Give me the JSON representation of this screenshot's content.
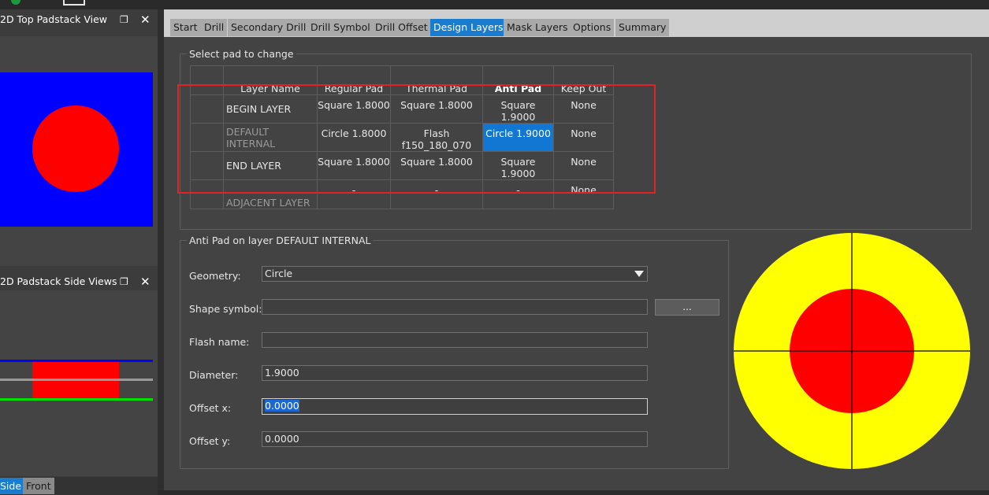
{
  "left": {
    "top_view_title": "2D Top Padstack View",
    "side_view_title": "2D Padstack Side Views",
    "view_tabs": [
      "Side",
      "Front"
    ],
    "colors": {
      "pad_bg": "#0000ff",
      "pad": "#ff0000",
      "layer_top": "#0000ff",
      "layer_mid": "#9a9a9a",
      "layer_bot": "#00e000"
    }
  },
  "tabs": [
    "Start",
    "Drill",
    "Secondary Drill",
    "Drill Symbol",
    "Drill Offset",
    "Design Layers",
    "Mask Layers",
    "Options",
    "Summary"
  ],
  "active_tab": "Design Layers",
  "select_group": {
    "title": "Select pad to change",
    "columns": [
      "Layer Name",
      "Regular Pad",
      "Thermal Pad",
      "Anti Pad",
      "Keep Out"
    ],
    "rows": [
      {
        "layer": "BEGIN LAYER",
        "regular": "Square 1.8000",
        "thermal": "Square 1.8000",
        "anti": "Square 1.9000",
        "keepout": "None"
      },
      {
        "layer": "DEFAULT INTERNAL",
        "regular": "Circle 1.8000",
        "thermal": "Flash f150_180_070",
        "anti": "Circle 1.9000",
        "keepout": "None"
      },
      {
        "layer": "END LAYER",
        "regular": "Square 1.8000",
        "thermal": "Square 1.8000",
        "anti": "Square 1.9000",
        "keepout": "None"
      },
      {
        "layer": "ADJACENT LAYER",
        "regular": "-",
        "thermal": "-",
        "anti": "-",
        "keepout": "None"
      }
    ]
  },
  "edit_group": {
    "title": "Anti Pad on layer DEFAULT INTERNAL",
    "geometry_label": "Geometry:",
    "geometry_value": "Circle",
    "shape_symbol_label": "Shape symbol:",
    "shape_symbol_value": "",
    "browse_label": "...",
    "flash_name_label": "Flash name:",
    "flash_name_value": "",
    "diameter_label": "Diameter:",
    "diameter_value": "1.9000",
    "offset_x_label": "Offset x:",
    "offset_x_value": "0.0000",
    "offset_y_label": "Offset y:",
    "offset_y_value": "0.0000"
  },
  "preview": {
    "outer_color": "#ffff00",
    "inner_color": "#ff0000",
    "crosshair_color": "#000000"
  }
}
